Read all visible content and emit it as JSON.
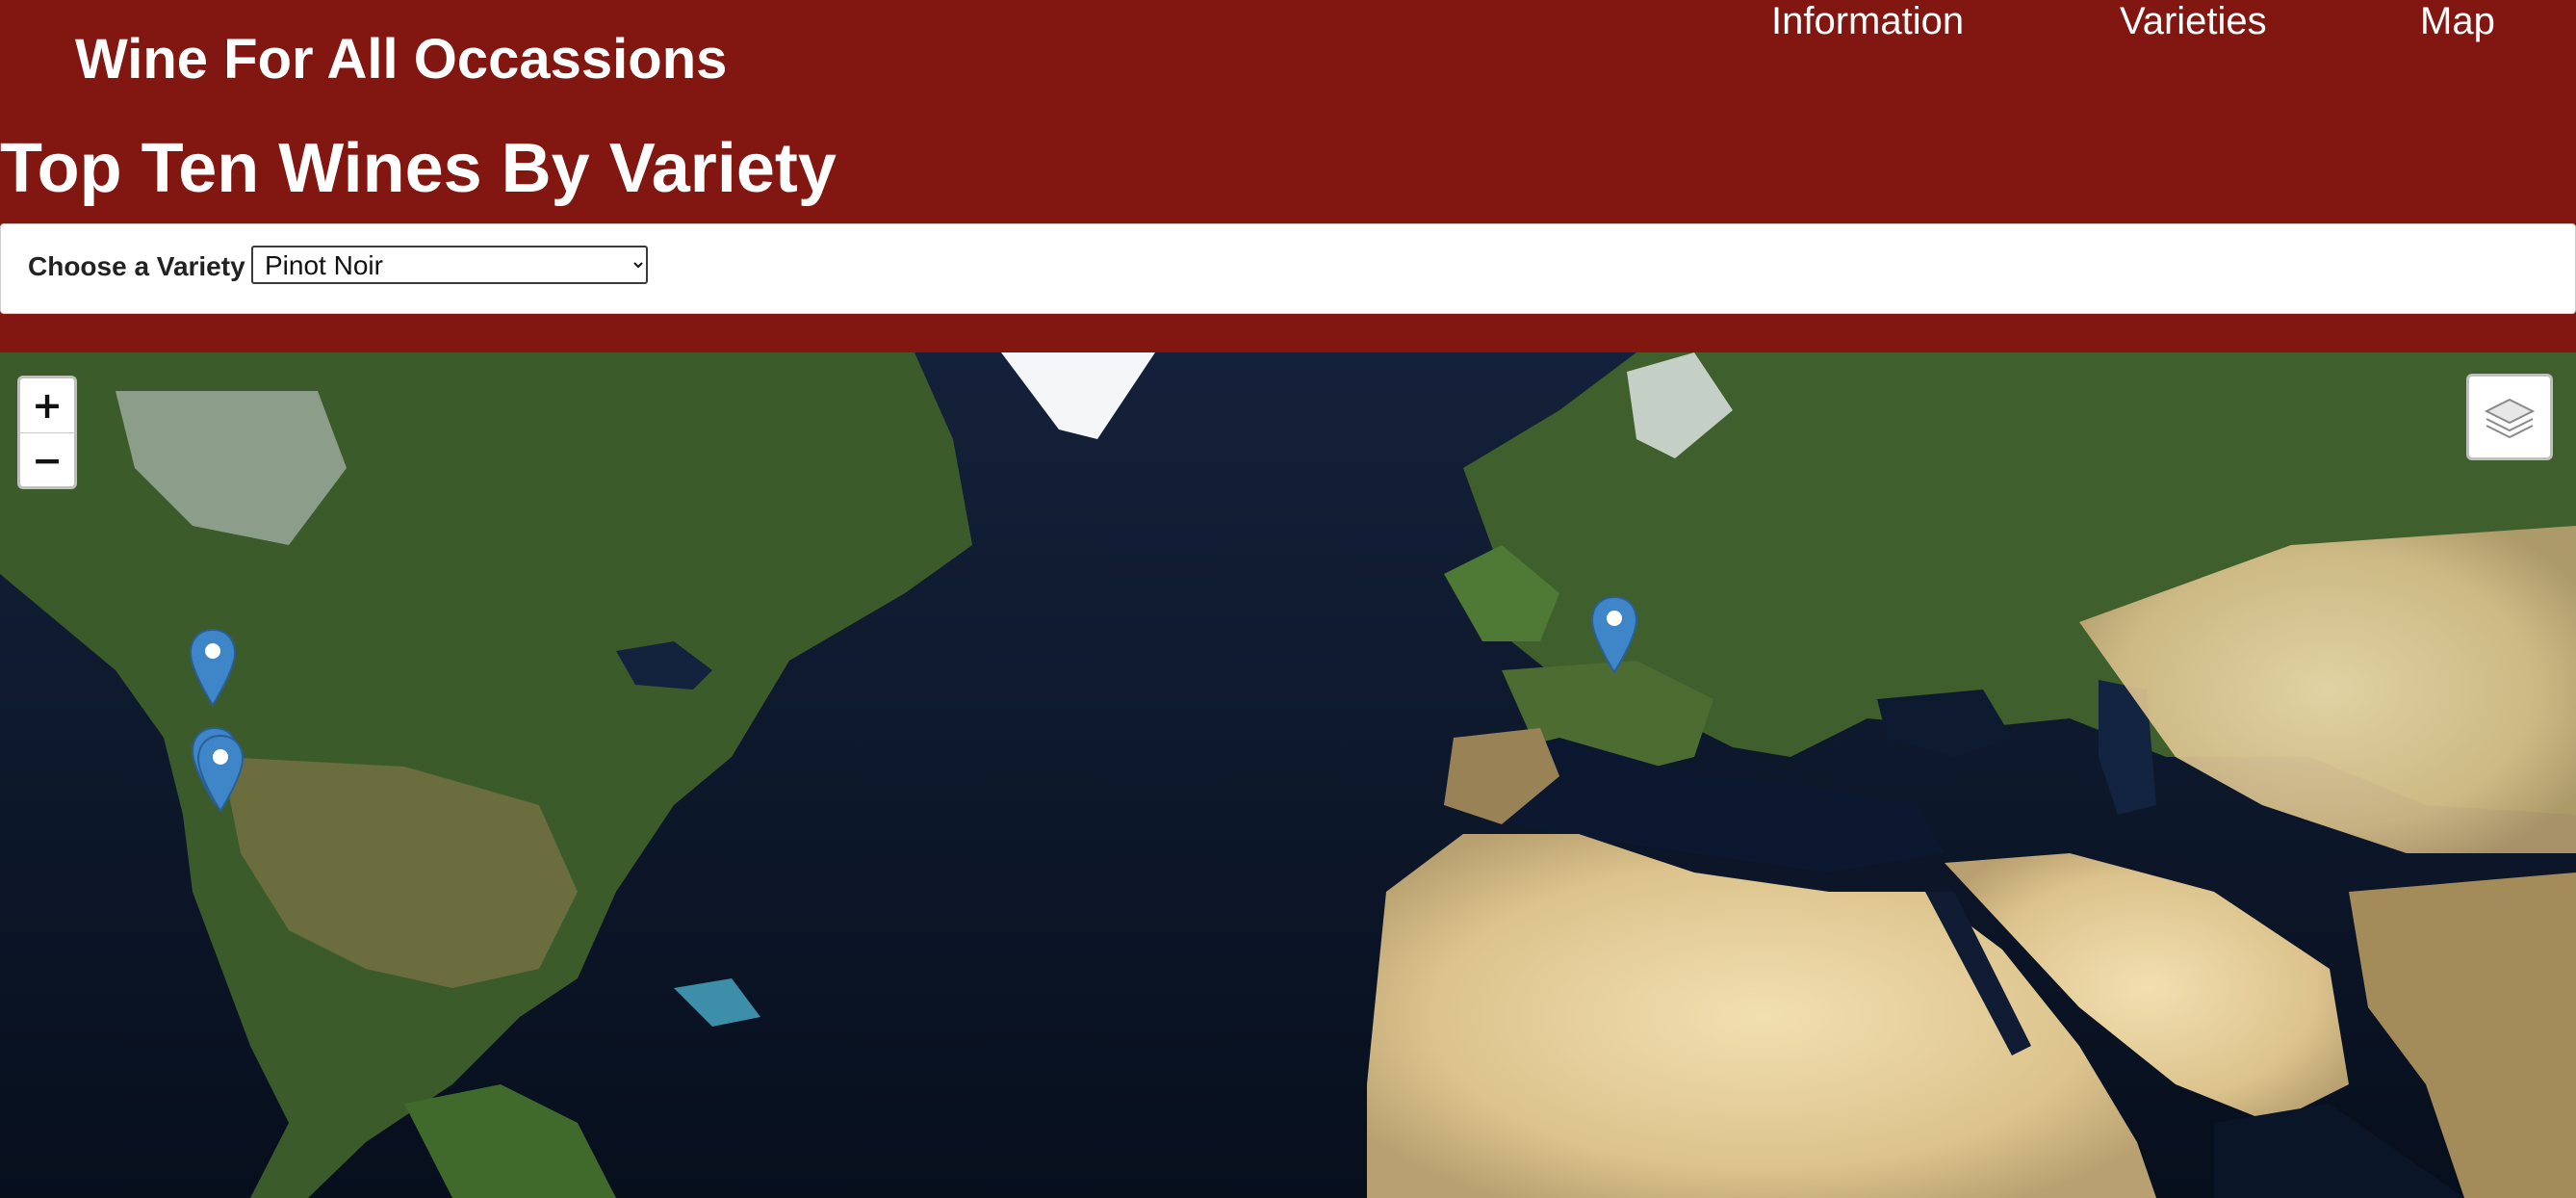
{
  "header": {
    "brand": "Wine For All Occassions",
    "nav": [
      "Information",
      "Varieties",
      "Map"
    ]
  },
  "page": {
    "title": "Top Ten Wines By Variety"
  },
  "variety_selector": {
    "label": "Choose a Variety",
    "selected": "Pinot Noir"
  },
  "map": {
    "controls": {
      "zoom_in": "+",
      "zoom_out": "−"
    },
    "layer_icon": "layers-icon",
    "marker_icon": "map-pin-icon",
    "marker_color": "#3f86c9"
  },
  "colors": {
    "brand_red": "#821711",
    "white": "#ffffff"
  }
}
